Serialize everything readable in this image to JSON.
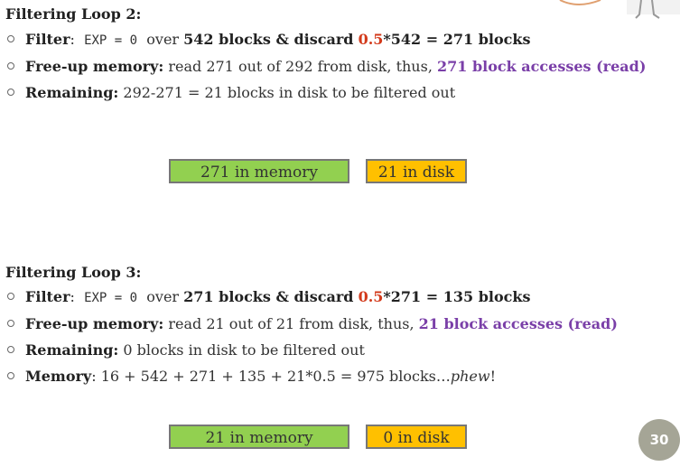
{
  "loop2": {
    "heading": "Filtering Loop 2:",
    "filter": {
      "label": "Filter",
      "colon": ":",
      "code": "EXP = 0",
      "over": "over",
      "blocks": "542 blocks & discard",
      "ratio": "0.5",
      "result": "*542 = 271 blocks"
    },
    "freeup": {
      "label": "Free-up memory:",
      "text": " read 271 out of 292 from disk, thus, ",
      "accesses": "271 block accesses (read)"
    },
    "remaining": {
      "label": "Remaining:",
      "text": " 292-271 = 21 blocks in disk to be filtered out"
    },
    "memory_box": "271 in memory",
    "disk_box": "21 in disk"
  },
  "loop3": {
    "heading": "Filtering Loop 3:",
    "filter": {
      "label": "Filter",
      "colon": ":",
      "code": "EXP = 0",
      "over": "over",
      "blocks": "271 blocks & discard",
      "ratio": "0.5",
      "result": "*271 = 135 blocks"
    },
    "freeup": {
      "label": "Free-up memory:",
      "text": " read 21 out of 21 from disk, thus, ",
      "accesses": "21 block accesses (read)"
    },
    "remaining": {
      "label": "Remaining:",
      "text": " 0  blocks in disk to be filtered out"
    },
    "memory": {
      "label": "Memory",
      "text": ": 16 + 542 + 271 + 135 + 21*0.5 = 975 blocks…",
      "emph": "phew",
      "end": "!"
    },
    "memory_box": "21 in memory",
    "disk_box": "0 in disk"
  },
  "page_number": "30",
  "colors": {
    "green": "#92d050",
    "orange": "#ffc000",
    "red": "#d33a1b",
    "purple": "#7a3fa8"
  }
}
